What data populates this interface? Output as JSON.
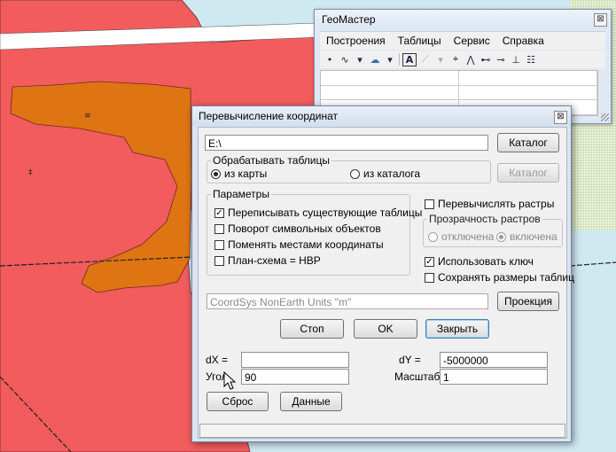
{
  "toolbar_window": {
    "title": "ГеоМастер",
    "close_glyph": "⊠",
    "menu": [
      "Построения",
      "Таблицы",
      "Сервис",
      "Справка"
    ],
    "tool_icons": [
      "point-tool-icon",
      "polyline-tool-icon",
      "dropdown-arrow-icon",
      "region-tool-icon",
      "dropdown-arrow-icon",
      "text-tool-icon",
      "brush-tool-icon",
      "dropdown-arrow-icon",
      "center-target-icon",
      "vertex-tool-icon",
      "node-edit-icon",
      "split-line-icon",
      "perpendicular-icon",
      "settings-icon"
    ],
    "tool_glyphs": [
      "•",
      "∿",
      "▾",
      "☁",
      "▾",
      "A",
      "⟋",
      "▾",
      "⌖",
      "⋀",
      "⊷",
      "⊸",
      "⊥",
      "☷"
    ]
  },
  "dialog": {
    "title": "Перевычисление координат",
    "close_glyph": "⊠",
    "path_value": "E:\\",
    "catalog_button": "Каталог",
    "process_tables": {
      "legend": "Обрабатывать таблицы",
      "from_map": "из карты",
      "from_catalog": "из каталога",
      "selected": "from_map",
      "catalog_button": "Каталог"
    },
    "params": {
      "legend": "Параметры",
      "items": [
        {
          "label": "Переписывать существующие таблицы",
          "checked": true
        },
        {
          "label": "Поворот символьных объектов",
          "checked": false
        },
        {
          "label": "Поменять местами координаты",
          "checked": false
        },
        {
          "label": "План-схема = НВР",
          "checked": false
        }
      ]
    },
    "recompute_rasters": {
      "label": "Перевычислять растры",
      "checked": false
    },
    "transparency": {
      "legend": "Прозрачность растров",
      "off": "отключена",
      "on": "включена",
      "selected": "on"
    },
    "use_key": {
      "label": "Использовать ключ",
      "checked": true
    },
    "keep_sizes": {
      "label": "Сохранять размеры таблиц",
      "checked": false
    },
    "coordsys_value": "CoordSys NonEarth Units \"m\"",
    "projection_button": "Проекция",
    "stop_button": "Стоп",
    "ok_button": "OK",
    "close_button": "Закрыть",
    "dx_label": "dX  =",
    "dx_value": "",
    "dy_label": "dY  =",
    "dy_value": "-5000000",
    "angle_label": "Угол",
    "angle_value": "90",
    "scale_label": "Масштаб",
    "scale_value": "1",
    "reset_button": "Сброс",
    "data_button": "Данные"
  },
  "colors": {
    "water": "#cfe9f1",
    "red_zone": "#f25c5c",
    "orange_zone": "#df7412",
    "window_frame": "#dbe4ef",
    "client_bg": "#f0f0f0"
  }
}
